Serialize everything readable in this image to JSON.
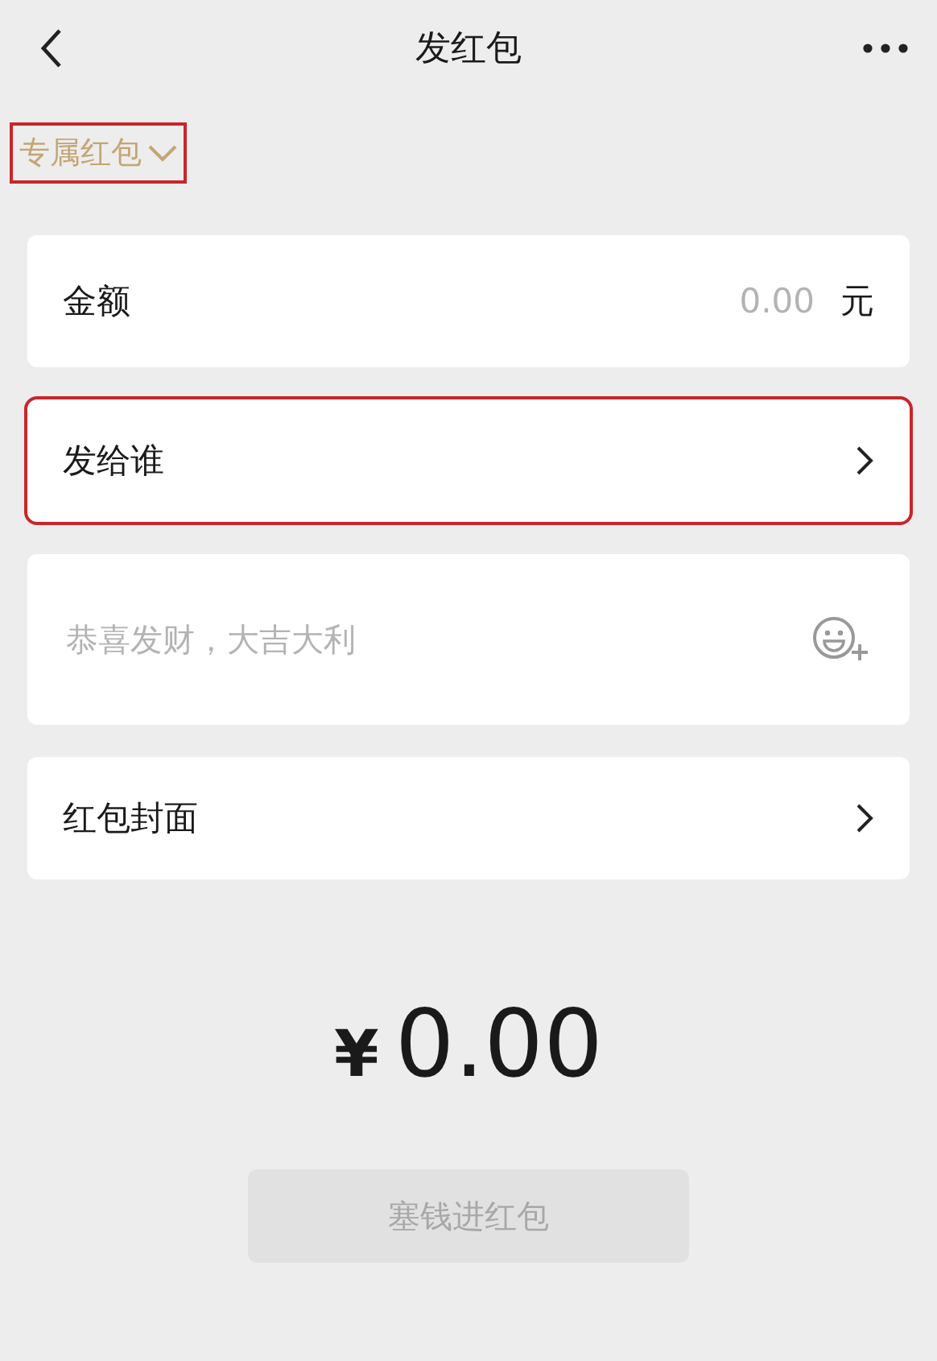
{
  "header": {
    "title": "发红包"
  },
  "packet_type": {
    "label": "专属红包",
    "highlighted": true
  },
  "rows": [
    {
      "kind": "amount",
      "label": "金额",
      "placeholder": "0.00",
      "unit": "元",
      "highlighted": false
    },
    {
      "kind": "link",
      "label": "发给谁",
      "highlighted": true
    },
    {
      "kind": "message",
      "placeholder": "恭喜发财，大吉大利",
      "highlighted": false
    },
    {
      "kind": "link",
      "label": "红包封面",
      "highlighted": false
    }
  ],
  "total": {
    "currency": "¥",
    "amount": "0.00"
  },
  "submit": {
    "label": "塞钱进红包",
    "disabled": true
  }
}
